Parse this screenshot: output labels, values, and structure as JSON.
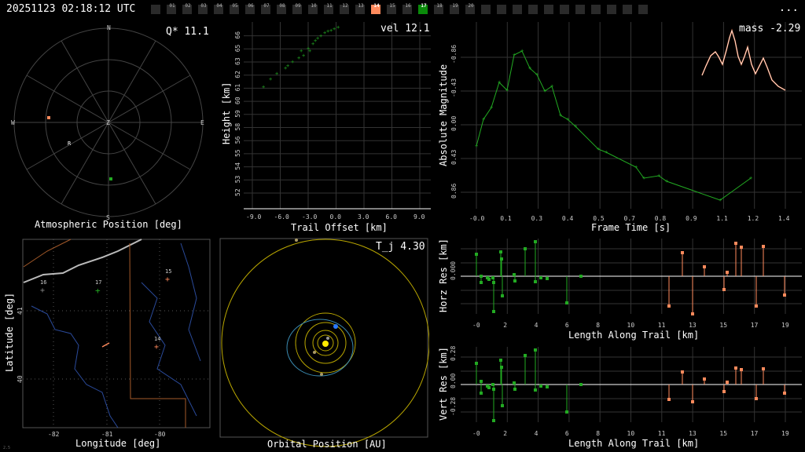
{
  "header": {
    "timestamp": "20251123 02:18:12 UTC",
    "menu": "...",
    "cameras": [
      {
        "label": "",
        "state": "off"
      },
      {
        "label": "01",
        "state": "off"
      },
      {
        "label": "02",
        "state": "off"
      },
      {
        "label": "03",
        "state": "off"
      },
      {
        "label": "04",
        "state": "off"
      },
      {
        "label": "05",
        "state": "off"
      },
      {
        "label": "06",
        "state": "off"
      },
      {
        "label": "07",
        "state": "off"
      },
      {
        "label": "08",
        "state": "off"
      },
      {
        "label": "09",
        "state": "off"
      },
      {
        "label": "10",
        "state": "off"
      },
      {
        "label": "11",
        "state": "off"
      },
      {
        "label": "12",
        "state": "off"
      },
      {
        "label": "13",
        "state": "off"
      },
      {
        "label": "14",
        "state": "orange"
      },
      {
        "label": "15",
        "state": "off"
      },
      {
        "label": "16",
        "state": "off"
      },
      {
        "label": "17",
        "state": "green"
      },
      {
        "label": "18",
        "state": "off"
      },
      {
        "label": "19",
        "state": "off"
      },
      {
        "label": "20",
        "state": "off"
      },
      {
        "label": "",
        "state": "off"
      },
      {
        "label": "",
        "state": "off"
      },
      {
        "label": "",
        "state": "off"
      },
      {
        "label": "",
        "state": "off"
      },
      {
        "label": "",
        "state": "off"
      },
      {
        "label": "",
        "state": "off"
      },
      {
        "label": "",
        "state": "off"
      },
      {
        "label": "",
        "state": "off"
      },
      {
        "label": "",
        "state": "off"
      },
      {
        "label": "",
        "state": "off"
      },
      {
        "label": "",
        "state": "off"
      }
    ]
  },
  "colors": {
    "green": "#22aa22",
    "orange": "#ff8a5c",
    "grid": "#444444",
    "camOff": "#2a2a2a"
  },
  "polar": {
    "caption": "Atmospheric Position [deg]",
    "value": "Q* 11.1",
    "north": "N",
    "south": "S",
    "east": "E",
    "west": "W",
    "zenith": "Z",
    "radiant": "R"
  },
  "height_chart": {
    "caption_x": "Trail Offset [km]",
    "caption_y": "Height [km]",
    "value": "vel 12.1",
    "xticks": [
      "-9.0",
      "-6.0",
      "-3.0",
      "0.0",
      "3.0",
      "6.0",
      "9.0"
    ],
    "yticks": [
      "52",
      "53",
      "54",
      "55",
      "56",
      "58",
      "59",
      "60",
      "61",
      "62",
      "63",
      "65",
      "66"
    ]
  },
  "mag_chart": {
    "caption_x": "Frame Time [s]",
    "caption_y": "Absolute Magnitude",
    "value": "mass -2.29",
    "xticks": [
      "-0.0",
      "0.1",
      "0.3",
      "0.4",
      "0.5",
      "0.7",
      "0.8",
      "0.9",
      "1.1",
      "1.2",
      "1.4"
    ],
    "yticks": [
      "-0.86",
      "-0.43",
      "0.00",
      "0.43",
      "0.86"
    ]
  },
  "map": {
    "caption_x": "Longitude [deg]",
    "caption_y": "Latitude [deg]",
    "xticks": [
      "-82",
      "-81",
      "-80"
    ],
    "yticks": [
      "41",
      "40"
    ],
    "stations": [
      "16",
      "17",
      "15",
      "14"
    ]
  },
  "orbit": {
    "caption": "Orbital Position [AU]",
    "value": "T_j 4.30"
  },
  "horz_res": {
    "caption_x": "Length Along Trail [km]",
    "caption_y": "Horz Res [km]",
    "xticks": [
      "-0",
      "2",
      "4",
      "6",
      "8",
      "10",
      "11",
      "13",
      "15",
      "17",
      "19"
    ],
    "yticks": [
      "0.000"
    ]
  },
  "vert_res": {
    "caption_x": "Length Along Trail [km]",
    "caption_y": "Vert Res [km]",
    "xticks": [
      "-0",
      "2",
      "4",
      "6",
      "8",
      "10",
      "11",
      "13",
      "15",
      "17",
      "19"
    ],
    "yticks": [
      "0.28",
      "0.00",
      "-0.28"
    ]
  },
  "footer": {
    "corner": "2.5"
  }
}
